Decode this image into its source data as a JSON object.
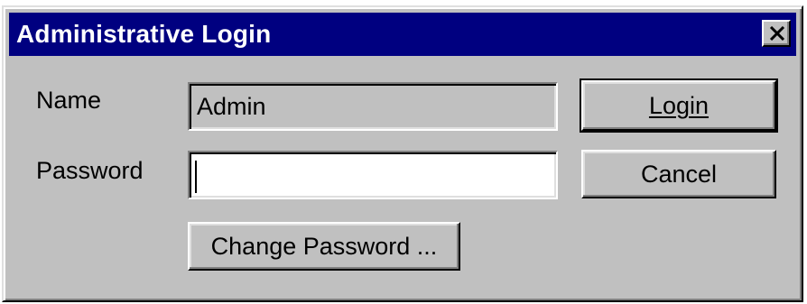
{
  "window": {
    "title": "Administrative Login",
    "close_glyph": "✕"
  },
  "form": {
    "name_label": "Name",
    "name_value": "Admin",
    "password_label": "Password",
    "password_value": ""
  },
  "buttons": {
    "login_label": "Login",
    "cancel_label": "Cancel",
    "change_password_label": "Change Password ..."
  },
  "colors": {
    "titlebar": "#000080",
    "face": "#c0c0c0",
    "field_bg": "#ffffff"
  }
}
